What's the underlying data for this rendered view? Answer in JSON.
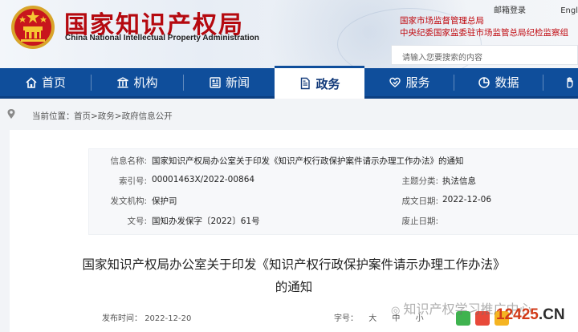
{
  "header": {
    "title_cn": "国家知识产权局",
    "title_en": "China National Intellectual Property Administration",
    "mail_login": "邮箱登录",
    "lang": "Engl",
    "red_link_1": "国家市场监督管理总局",
    "red_link_2": "中央纪委国家监委驻市场监管总局纪检监察组",
    "search_placeholder": "请输入您要搜索的内容"
  },
  "nav": {
    "items": [
      {
        "label": "首页",
        "icon": "home-icon"
      },
      {
        "label": "机构",
        "icon": "building-icon"
      },
      {
        "label": "新闻",
        "icon": "news-icon"
      },
      {
        "label": "政务",
        "icon": "document-icon"
      },
      {
        "label": "服务",
        "icon": "heart-hand-icon"
      },
      {
        "label": "数据",
        "icon": "pie-chart-icon"
      },
      {
        "label": "",
        "icon": "hand-icon"
      }
    ],
    "active_index": 3
  },
  "breadcrumb": {
    "prefix": "当前位置：",
    "path": "首页>政务>政府信息公开"
  },
  "info": {
    "title_label": "信息名称:",
    "title_value": "国家知识产权局办公室关于印发《知识产权行政保护案件请示办理工作办法》的通知",
    "index_label": "索引号:",
    "index_value": "00001463X/2022-00864",
    "topic_label": "主题分类:",
    "topic_value": "执法信息",
    "org_label": "发文机构:",
    "org_value": "保护司",
    "date_label": "成文日期:",
    "date_value": "2022-12-06",
    "doc_no_label": "文号:",
    "doc_no_value": "国知办发保字〔2022〕61号",
    "expire_label": "废止日期:",
    "expire_value": ""
  },
  "article": {
    "title_line1": "国家知识产权局办公室关于印发《知识产权行政保护案件请示办理工作办法》",
    "title_line2": "的通知",
    "publish_label": "发布时间：",
    "publish_date": "2022-12-20",
    "font_label": "字号：",
    "size_large": "大",
    "size_medium": "中",
    "size_small": "小"
  },
  "watermark": {
    "wechat_text": "知识产权学习推广中心",
    "site_logo_num": "12425",
    "site_logo_dot": ".",
    "site_logo_cn": "CN"
  },
  "colors": {
    "brand_red": "#b5090f",
    "nav_blue": "#0f4e9b"
  }
}
